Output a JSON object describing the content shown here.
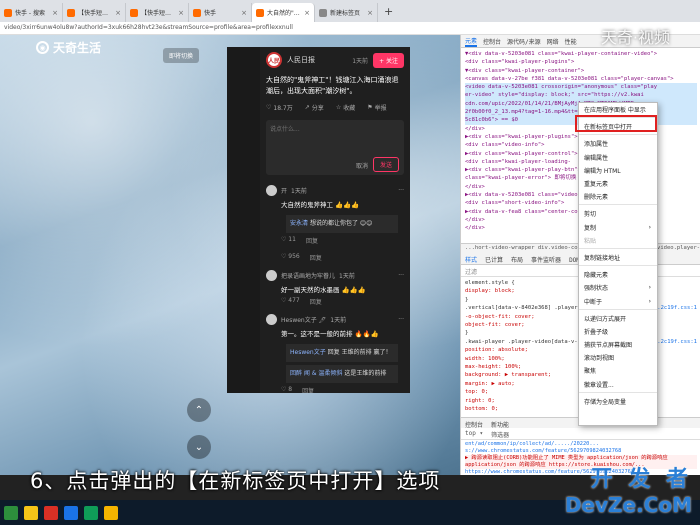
{
  "browser": {
    "tabs": [
      {
        "title": "快手 - 搜索",
        "color": "#ff6a00",
        "active": false
      },
      {
        "title": "【快手短视频App】快手,拥",
        "color": "#ff6a00",
        "active": false
      },
      {
        "title": "【快手短视频App】快手,拥",
        "color": "#ff6a00",
        "active": false
      },
      {
        "title": "快手",
        "color": "#ff6a00",
        "active": false
      },
      {
        "title": "大自然的\"鬼斧神工\"!钱塘",
        "color": "#ff6a00",
        "active": true
      },
      {
        "title": "新建标签页",
        "color": "#888888",
        "active": false
      }
    ],
    "new_tab_symbol": "+",
    "address": "video/3xirr6unw4olu8w?authorId=3xuk66h28hvt23e&streamSource=profile&area=profilexxnull"
  },
  "page": {
    "logo_text": "天奇生活",
    "switch_label": "即将切换",
    "nav_up": "⌃",
    "nav_down": "⌄",
    "author": "人民日报",
    "author_time": "1天前",
    "avatar_text": "人民",
    "follow_label": "+ 关注",
    "caption": "大自然的\"鬼斧神工\"！钱塘江入海口涌浪退潮后，出现大面积\"潮汐树\"。",
    "likes": "18.7万",
    "share_label": "分享",
    "fav_label": "收藏",
    "report_label": "举报",
    "compose_placeholder": "说点什么...",
    "cancel_label": "取消",
    "send_label": "发送",
    "comments": [
      {
        "user": "开",
        "time": "1天前",
        "text": "大自然的鬼斧神工 👍👍👍",
        "reply_who": "安永清",
        "reply_text": "想说的都让你包了 😊😊",
        "replies": "11",
        "reply_label": "回复"
      },
      {
        "user": "",
        "time": "",
        "text": "",
        "reply_who": "",
        "reply_text": "",
        "replies": "956",
        "reply_label": "回复"
      },
      {
        "user": "把录语画地为牢眷儿",
        "time": "1天前",
        "text": "好一副天然的水墨画 👍👍👍",
        "reply_who": "",
        "reply_text": "",
        "replies": "477",
        "reply_label": "回复"
      },
      {
        "user": "Heswen文子 🖊",
        "time": "1天前",
        "text": "第一。这不是一般的前排 🔥🔥👍",
        "reply_who": "Heswen文子",
        "reply_text": "回复 王维的前排 赢了！",
        "replies": "8",
        "reply_label": "回复"
      }
    ],
    "reply2_who": "回醉 闻 & 温柔倾斜",
    "reply2_text": "这是王维的前排",
    "reply2_count": "2",
    "more_dots": "···"
  },
  "devtools": {
    "tabs": [
      "元素",
      "控制台",
      "源代码/来源",
      "网络",
      "性能"
    ],
    "element_lines": [
      "▼<div data-v-5203e081 class=\"kwai-player-container-video\">",
      "  <div class=\"kwai-player-plugins\">",
      "  ▼<div class=\"kwai-player-container\">",
      "   <canvas data-v-27be f381 data-v-5203e081 class=\"player-canvas\">",
      "   <video data-v-5203e081 crossorigin=\"anonymous\" class=\"play",
      "    er-video\" style=\"display: block;\" src=\"https://v2.kwai",
      "    cdn.com/upic/2022/01/14/21/BMjAyMjAxMTQyMTE0MDdfMTEz",
      "    2f0b00f0_2_13.mp4?tag=1-16.mp4&tt=b&tt=86%2F",
      "    5c81c0b6\"> == $0",
      "  </div>",
      "  ▶<div class=\"kwai-player-plugins\">",
      "   <div class=\"video-info\">",
      "   ▶<div class=\"kwai-player-control\">",
      "    <div class=\"kwai-player-loading-",
      "   ▶<div class=\"kwai-player-play-btn\">",
      "    class=\"kwai-player-error\"> 即将切换",
      "   </div>",
      "  ▶<div data-v-5203e081 class=\"video-header\">",
      "   <div class=\"short-video-info\">",
      "  ▶<div data-v-fea8 class=\"center-cont\">",
      "   </div>",
      "  </div>",
      "",
      ""
    ],
    "breadcrumb": "...hort-video-wrapper  div.video-container  div.kwai-player  video.player-video",
    "style_tabs": [
      "样式",
      "已计算",
      "布局",
      "事件监听器",
      "DOM 断点",
      "属性"
    ],
    "filter_placeholder": "过滤",
    "style_lines": [
      "element.style {",
      "  display: block;",
      "}",
      ".vertical[data-v-8402e368] .player-video {",
      "  -o-object-fit: cover;",
      "  object-fit: cover;",
      "}",
      ".kwai-player .player-video[data-v-5203e081] {",
      "  position: absolute;",
      "  width: 100%;",
      "  max-height: 100%;",
      "  background: ▶ transparent;",
      "  margin: ▶ auto;",
      "  top: 0;",
      "  right: 0;",
      "  bottom: 0;"
    ],
    "style_src": "kwai-mo.2c19f.css:1",
    "console_tabs": [
      "控制台",
      "新功能"
    ],
    "console_bar": [
      "top ▾",
      "筛选器"
    ],
    "console_lines": [
      "ent/ad/common/ip/collect/ad/...../20220...",
      "s://www.chromestatus.com/feature/5629709824032768",
      "▶ 跨源读取阻止(CORB)功能阻止了 MIME 类型为 application/json 的跨源响应",
      "application/json 的跨源响应 https://store.kuaishou.com/...",
      "https://www.chromestatus.com/feature/5629709824032768"
    ]
  },
  "context_menu": {
    "items": [
      {
        "label": "在应用程序面板 中显示",
        "disabled": false,
        "sub": false,
        "sep_after": true
      },
      {
        "label": "在新标签页中打开",
        "disabled": false,
        "sub": false,
        "sep_after": true
      },
      {
        "label": "添加属性",
        "disabled": false,
        "sub": false,
        "sep_after": false
      },
      {
        "label": "编辑属性",
        "disabled": false,
        "sub": false,
        "sep_after": false
      },
      {
        "label": "编辑为 HTML",
        "disabled": false,
        "sub": false,
        "sep_after": false
      },
      {
        "label": "重复元素",
        "disabled": false,
        "sub": false,
        "sep_after": false
      },
      {
        "label": "删除元素",
        "disabled": false,
        "sub": false,
        "sep_after": true
      },
      {
        "label": "剪切",
        "disabled": false,
        "sub": false,
        "sep_after": false
      },
      {
        "label": "复制",
        "disabled": false,
        "sub": true,
        "sep_after": false
      },
      {
        "label": "粘贴",
        "disabled": true,
        "sub": false,
        "sep_after": true
      },
      {
        "label": "复制链接地址",
        "disabled": false,
        "sub": false,
        "sep_after": true
      },
      {
        "label": "隐藏元素",
        "disabled": false,
        "sub": false,
        "sep_after": false
      },
      {
        "label": "强制状态",
        "disabled": false,
        "sub": true,
        "sep_after": false
      },
      {
        "label": "中断于",
        "disabled": false,
        "sub": true,
        "sep_after": true
      },
      {
        "label": "以递归方式展开",
        "disabled": false,
        "sub": false,
        "sep_after": false
      },
      {
        "label": "折叠子级",
        "disabled": false,
        "sub": false,
        "sep_after": false
      },
      {
        "label": "捕获节点屏幕截图",
        "disabled": false,
        "sub": false,
        "sep_after": false
      },
      {
        "label": "滚动到视图",
        "disabled": false,
        "sub": false,
        "sep_after": false
      },
      {
        "label": "聚焦",
        "disabled": false,
        "sub": false,
        "sep_after": false
      },
      {
        "label": "徽章设置...",
        "disabled": false,
        "sub": false,
        "sep_after": true
      },
      {
        "label": "存储为全局变量",
        "disabled": false,
        "sub": false,
        "sep_after": false
      }
    ]
  },
  "overlay": {
    "subtitle": "6、点击弹出的【在新标签页中打开】选项",
    "watermark_top": "天奇·视频",
    "watermark_a": "开 发 者",
    "watermark_b": "DevZe.CoM"
  },
  "taskbar": {
    "icons": [
      "#2d8f3c",
      "#f5c518",
      "#d93025",
      "#1a73e8",
      "#0f9d58",
      "#f4b400"
    ]
  }
}
